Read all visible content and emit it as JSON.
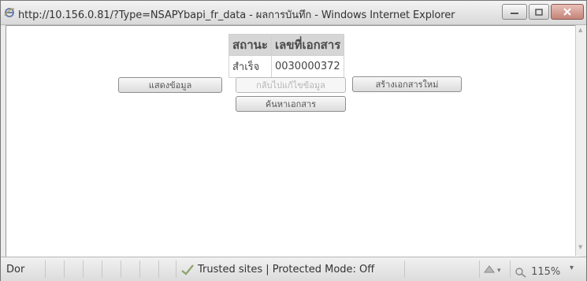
{
  "window": {
    "title": "http://10.156.0.81/?Type=NSAPYbapi_fr_data - ผลการบันทึก - Windows Internet Explorer"
  },
  "result_table": {
    "headers": [
      "สถานะ",
      "เลขที่เอกสาร"
    ],
    "rows": [
      [
        "สำเร็จ",
        "0030000372"
      ]
    ]
  },
  "buttons": {
    "show_data": "แสดงข้อมูล",
    "back_edit": "กลับไปแก้ไขข้อมูล",
    "new_document": "สร้างเอกสารใหม่",
    "search_document": "ค้นหาเอกสาร"
  },
  "statusbar": {
    "left": "Dor",
    "zone": "Trusted sites | Protected Mode: Off",
    "zoom": "115%"
  },
  "icons": {
    "window": "internet-explorer-icon",
    "zone": "checkmark-icon",
    "security": "security-icon",
    "zoom": "zoom-icon"
  }
}
